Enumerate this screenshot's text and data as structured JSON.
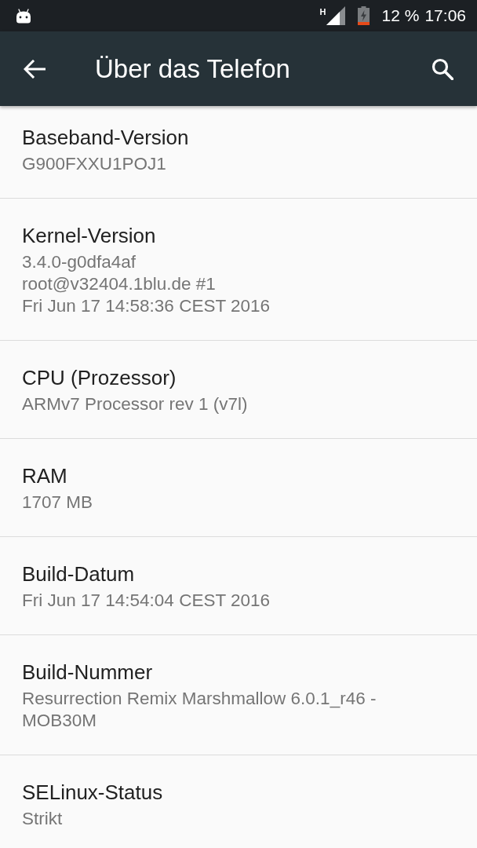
{
  "status_bar": {
    "network_type": "H",
    "battery_percent": "12 %",
    "time": "17:06"
  },
  "app_bar": {
    "title": "Über das Telefon"
  },
  "items": [
    {
      "title": "Baseband-Version",
      "summary": "G900FXXU1POJ1"
    },
    {
      "title": "Kernel-Version",
      "summary": "3.4.0-g0dfa4af\nroot@v32404.1blu.de #1\nFri Jun 17 14:58:36 CEST 2016"
    },
    {
      "title": "CPU (Prozessor)",
      "summary": "ARMv7 Processor rev 1 (v7l)"
    },
    {
      "title": "RAM",
      "summary": "1707 MB"
    },
    {
      "title": "Build-Datum",
      "summary": "Fri Jun 17 14:54:04 CEST 2016"
    },
    {
      "title": "Build-Nummer",
      "summary": "Resurrection Remix Marshmallow 6.0.1_r46 - MOB30M"
    },
    {
      "title": "SELinux-Status",
      "summary": "Strikt"
    }
  ]
}
